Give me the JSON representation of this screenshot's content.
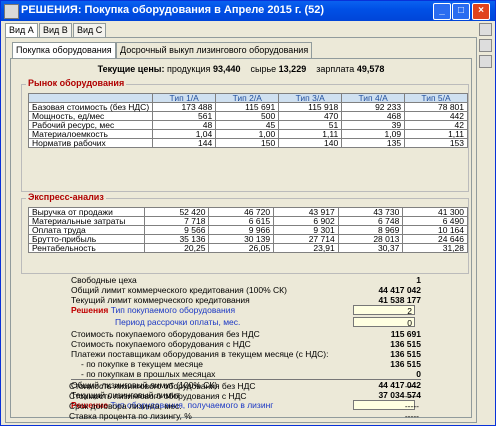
{
  "window": {
    "title": "РЕШЕНИЯ: Покупка оборудования в Апреле 2015 г. (52)",
    "min": "_",
    "max": "□",
    "close": "×"
  },
  "view_tabs": [
    "Вид А",
    "Вид B",
    "Вид C"
  ],
  "sub_tabs": [
    "Покупка оборудования",
    "Досрочный выкуп лизингового оборудования"
  ],
  "prices": {
    "label": "Текущие цены:",
    "product_label": "продукция",
    "product": "93,440",
    "raw_label": "сырье",
    "raw": "13,229",
    "salary_label": "зарплата",
    "salary": "49,578"
  },
  "market": {
    "title": "Рынок оборудования",
    "columns": [
      "Тип 1/А",
      "Тип 2/А",
      "Тип 3/А",
      "Тип 4/А",
      "Тип 5/А"
    ],
    "rows": [
      {
        "label": "Базовая стоимость (без НДС)",
        "values": [
          "173 488",
          "115 691",
          "115 918",
          "92 233",
          "78 801"
        ]
      },
      {
        "label": "Мощность, ед/мес",
        "values": [
          "561",
          "500",
          "470",
          "468",
          "442"
        ]
      },
      {
        "label": "Рабочий ресурс, мес",
        "values": [
          "48",
          "45",
          "51",
          "39",
          "42"
        ]
      },
      {
        "label": "Материалоемкость",
        "values": [
          "1,04",
          "1,00",
          "1,11",
          "1,09",
          "1,11"
        ]
      },
      {
        "label": "Норматив рабочих",
        "values": [
          "144",
          "150",
          "140",
          "135",
          "153"
        ]
      }
    ]
  },
  "express": {
    "title": "Экспресс-анализ",
    "rows": [
      {
        "label": "Выручка от продажи",
        "values": [
          "52 420",
          "46 720",
          "43 917",
          "43 730",
          "41 300"
        ]
      },
      {
        "label": "Материальные затраты",
        "values": [
          "7 718",
          "6 615",
          "6 902",
          "6 748",
          "6 490"
        ]
      },
      {
        "label": "Оплата труда",
        "values": [
          "9 566",
          "9 966",
          "9 301",
          "8 969",
          "10 164"
        ]
      },
      {
        "label": "Брутто-прибыль",
        "values": [
          "35 136",
          "30 139",
          "27 714",
          "28 013",
          "24 646"
        ]
      },
      {
        "label": "Рентабельность",
        "values": [
          "20,25",
          "26,05",
          "23,91",
          "30,37",
          "31,28"
        ]
      }
    ]
  },
  "info": {
    "free_shops": {
      "label": "Свободные цеха",
      "value": "1"
    },
    "credit_limit": {
      "label": "Общий лимит коммерческого кредитования (100% СК)",
      "value": "44 417 042"
    },
    "cur_credit_limit": {
      "label": "Текущий лимит коммерческого кредитования",
      "value": "41 538 177"
    },
    "decision1_label": "Решения",
    "type_label": "Тип покупаемого оборудования",
    "type_value": "2",
    "period_label": "Период рассрочки оплаты, мес.",
    "period_value": "0",
    "cost_no_vat": {
      "label": "Стоимость покупаемого оборудования без НДС",
      "value": "115 691"
    },
    "cost_vat": {
      "label": "Стоимость покупаемого оборудования с НДС",
      "value": "136 515"
    },
    "supplier_pay": {
      "label": "Платежи поставщикам оборудования в текущем месяце (с НДС):",
      "value": "136 515"
    },
    "buy_cur": {
      "label": "- по покупке в текущем месяце",
      "value": "136 515"
    },
    "buy_prev": {
      "label": "- по покупкам в прошлых месяцах",
      "value": "0"
    },
    "leasing_limit": {
      "label": "Общий лизинговый лимит (100% СК)",
      "value": "44 417 042"
    },
    "cur_leasing": {
      "label": "Текущий лизинговый лимит",
      "value": "37 034 574"
    },
    "decision2_label": "Решение",
    "lease_type_label": "Тип оборудования, получаемого в лизинг",
    "lease_type_value": "",
    "lease_no_vat": {
      "label": "Стоимость лизингового оборудования без НДС",
      "value": "-----"
    },
    "lease_vat": {
      "label": "Стоимость лизингового оборудования с НДС",
      "value": "-----"
    },
    "lease_term": {
      "label": "Срок договора лизинга, мес.",
      "value": "-----"
    },
    "lease_rate": {
      "label": "Ставка процента по лизингу, %",
      "value": "-----"
    }
  }
}
